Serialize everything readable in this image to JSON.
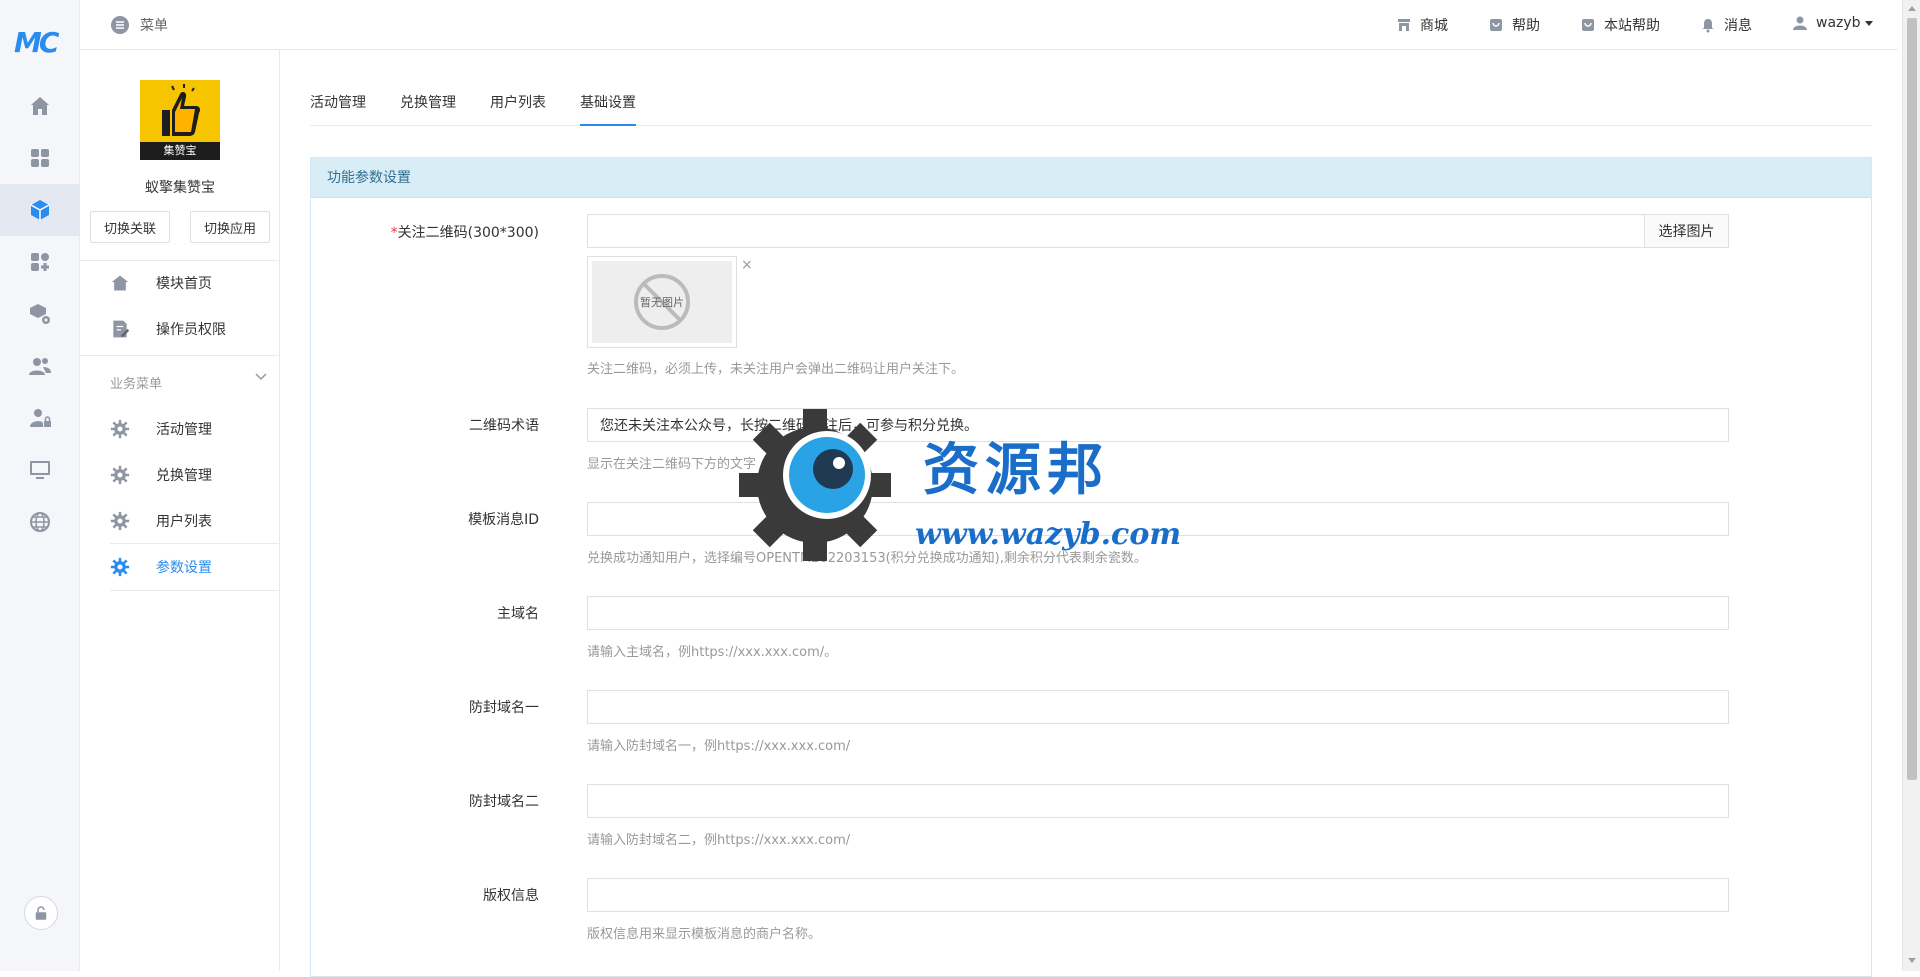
{
  "header": {
    "menu_label": "菜单",
    "links": [
      {
        "label": "商城",
        "icon": "shop-icon"
      },
      {
        "label": "帮助",
        "icon": "help-icon"
      },
      {
        "label": "本站帮助",
        "icon": "site-help-icon"
      },
      {
        "label": "消息",
        "icon": "bell-icon"
      }
    ],
    "user": "wazyb"
  },
  "rail": {
    "logo": "MC",
    "icons": [
      "home-icon",
      "apps-grid-icon",
      "module-cube-icon",
      "plugin-icon",
      "package-settings-icon",
      "users-icon",
      "user-lock-icon",
      "monitor-icon",
      "globe-icon"
    ],
    "active_index": 2
  },
  "sidebar": {
    "app_logo_text": "集赞宝",
    "app_name": "蚁擎集赞宝",
    "switch_link_label": "切换关联",
    "switch_app_label": "切换应用",
    "top_items": [
      {
        "label": "模块首页",
        "icon": "home-icon"
      },
      {
        "label": "操作员权限",
        "icon": "edit-doc-icon"
      }
    ],
    "group_title": "业务菜单",
    "business_items": [
      {
        "label": "活动管理",
        "icon": "gear-icon"
      },
      {
        "label": "兑换管理",
        "icon": "gear-icon"
      },
      {
        "label": "用户列表",
        "icon": "gear-icon"
      },
      {
        "label": "参数设置",
        "icon": "gear-icon",
        "active": true
      }
    ]
  },
  "tabs": [
    {
      "label": "活动管理"
    },
    {
      "label": "兑换管理"
    },
    {
      "label": "用户列表"
    },
    {
      "label": "基础设置",
      "active": true
    }
  ],
  "panel": {
    "title": "功能参数设置",
    "fields": {
      "qrcode": {
        "label": "关注二维码(300*300)",
        "required_mark": "*",
        "value": "",
        "pick_button": "选择图片",
        "thumb_text": "暂无图片",
        "remove_glyph": "×",
        "help": "关注二维码，必须上传，未关注用户会弹出二维码让用户关注下。"
      },
      "qr_tip": {
        "label": "二维码术语",
        "value": "您还未关注本公众号，长按二维码关注后，可参与积分兑换。",
        "help": "显示在关注二维码下方的文字"
      },
      "template_id": {
        "label": "模板消息ID",
        "value": "",
        "help": "兑换成功通知用户，选择编号OPENTM202203153(积分兑换成功通知),剩余积分代表剩余瓷数。"
      },
      "main_domain": {
        "label": "主域名",
        "value": "",
        "help": "请输入主域名，例https://xxx.xxx.com/。"
      },
      "anti_domain_1": {
        "label": "防封域名一",
        "value": "",
        "help": "请输入防封域名一，例https://xxx.xxx.com/"
      },
      "anti_domain_2": {
        "label": "防封域名二",
        "value": "",
        "help": "请输入防封域名二，例https://xxx.xxx.com/"
      },
      "copyright": {
        "label": "版权信息",
        "value": "",
        "help": "版权信息用来显示模板消息的商户名称。"
      }
    }
  },
  "watermark": {
    "title": "资源邦",
    "url": "www.wazyb.com"
  },
  "colors": {
    "accent": "#2b8cf0",
    "panel_header_bg": "#d9edf7",
    "panel_header_text": "#31708f",
    "required": "#e4393c"
  }
}
